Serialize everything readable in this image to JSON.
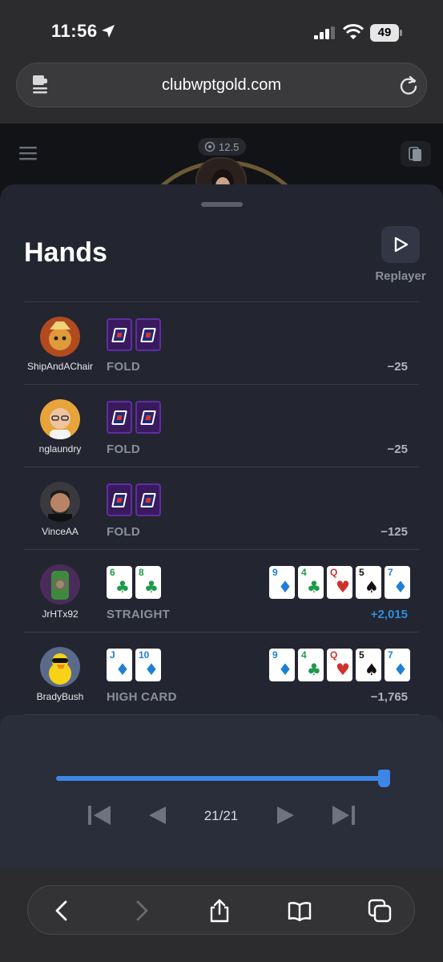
{
  "status_bar": {
    "time": "11:56",
    "battery": "49"
  },
  "browser": {
    "url": "clubwptgold.com"
  },
  "game": {
    "pot": "12.5"
  },
  "sheet": {
    "title": "Hands",
    "replayer_label": "Replayer"
  },
  "hands": [
    {
      "player": "ShipAndAChair",
      "result": "FOLD",
      "amount": "−25",
      "hole": [
        "back",
        "back"
      ],
      "board": []
    },
    {
      "player": "nglaundry",
      "result": "FOLD",
      "amount": "−25",
      "hole": [
        "back",
        "back"
      ],
      "board": []
    },
    {
      "player": "VinceAA",
      "result": "FOLD",
      "amount": "−125",
      "hole": [
        "back",
        "back"
      ],
      "board": []
    },
    {
      "player": "JrHTx92",
      "result": "STRAIGHT",
      "amount": "+2,015",
      "win": true,
      "hole": [
        {
          "rank": "6",
          "suit": "clubs"
        },
        {
          "rank": "8",
          "suit": "clubs"
        }
      ],
      "board": [
        {
          "rank": "9",
          "suit": "diamonds"
        },
        {
          "rank": "4",
          "suit": "clubs"
        },
        {
          "rank": "Q",
          "suit": "hearts"
        },
        {
          "rank": "5",
          "suit": "spades"
        },
        {
          "rank": "7",
          "suit": "diamonds"
        }
      ]
    },
    {
      "player": "BradyBush",
      "result": "HIGH CARD",
      "amount": "−1,765",
      "hole": [
        {
          "rank": "J",
          "suit": "diamonds"
        },
        {
          "rank": "10",
          "suit": "diamonds"
        }
      ],
      "board": [
        {
          "rank": "9",
          "suit": "diamonds"
        },
        {
          "rank": "4",
          "suit": "clubs"
        },
        {
          "rank": "Q",
          "suit": "hearts"
        },
        {
          "rank": "5",
          "suit": "spades"
        },
        {
          "rank": "7",
          "suit": "diamonds"
        }
      ]
    }
  ],
  "playback": {
    "counter": "21/21",
    "progress": 1.0
  },
  "suit_colors": {
    "clubs": "#1f9a4a",
    "diamonds": "#1f7fd6",
    "hearts": "#d0312d",
    "spades": "#111111"
  },
  "suit_glyphs": {
    "clubs": "♣",
    "diamonds": "♦",
    "hearts": "♥",
    "spades": "♠"
  },
  "accent_color": "#3e86e6",
  "win_color": "#2e8fd9"
}
